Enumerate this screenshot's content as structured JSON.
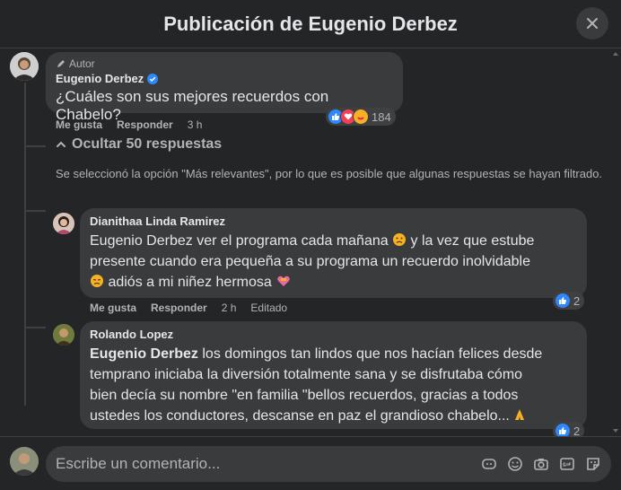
{
  "header": {
    "title": "Publicación de Eugenio Derbez"
  },
  "post": {
    "author_tag": "Autor",
    "name": "Eugenio Derbez",
    "text": "¿Cuáles son sus mejores recuerdos con Chabelo?",
    "like_label": "Me gusta",
    "reply_label": "Responder",
    "time": "3 h",
    "reaction_count": "184"
  },
  "thread": {
    "hide_label": "Ocultar 50 respuestas",
    "notice": "Se seleccionó la opción \"Más relevantes\", por lo que es posible que algunas respuestas se hayan filtrado."
  },
  "replies": [
    {
      "name": "Dianithaa Linda Ramirez",
      "line1": "Eugenio Derbez ver el programa cada mañana",
      "line1b": "y la vez que estube",
      "line2": "presente cuando era pequeña a su programa un recuerdo inolvidable",
      "line3": "adiós a mi niñez hermosa",
      "like_label": "Me gusta",
      "reply_label": "Responder",
      "time": "2 h",
      "edited": "Editado",
      "reaction_count": "2"
    },
    {
      "name": "Rolando Lopez",
      "mention": "Eugenio Derbez",
      "line1": "los domingos tan lindos que nos hacían felices desde",
      "line2": "temprano iniciaba la diversión totalmente sana y se disfrutaba cómo",
      "line3": "bien decía su nombre \"en familia \"bellos recuerdos, gracias a todos",
      "line4": "ustedes los conductores, descanse en paz el grandioso chabelo...",
      "reaction_count": "2"
    }
  ],
  "composer": {
    "placeholder": "Escribe un comentario..."
  },
  "colors": {
    "accent": "#2d88ff",
    "bg": "#242526",
    "bubble": "#3a3b3c"
  }
}
